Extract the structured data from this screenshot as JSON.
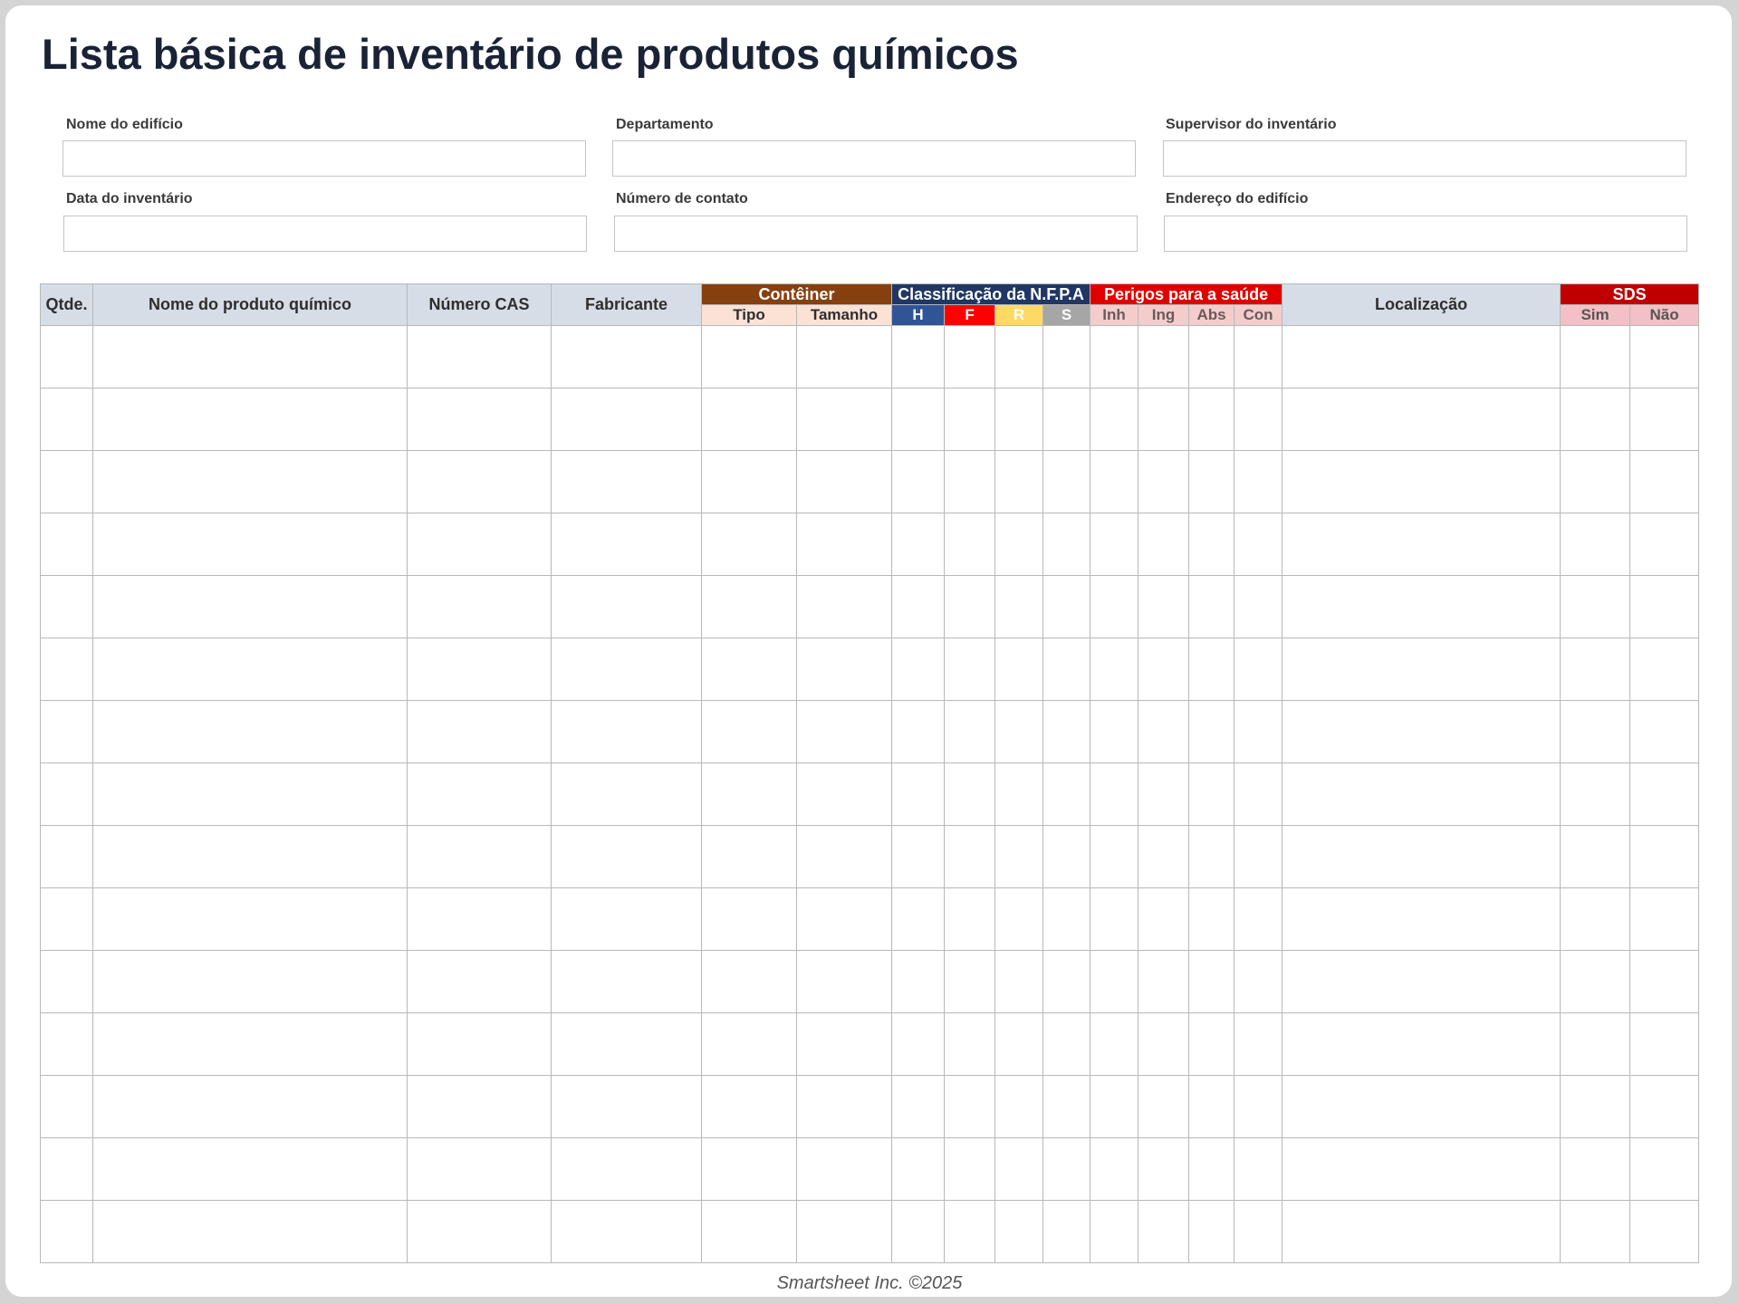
{
  "title": "Lista básica de inventário de produtos químicos",
  "fields": [
    {
      "label": "Nome do edifício",
      "value": ""
    },
    {
      "label": "Departamento",
      "value": ""
    },
    {
      "label": "Supervisor do inventário",
      "value": ""
    },
    {
      "label": "Data do inventário",
      "value": ""
    },
    {
      "label": "Número de contato",
      "value": ""
    },
    {
      "label": "Endereço do edifício",
      "value": ""
    }
  ],
  "table": {
    "headers": {
      "qty": "Qtde.",
      "chemical_name": "Nome do produto químico",
      "cas_number": "Número CAS",
      "manufacturer": "Fabricante",
      "location": "Localização"
    },
    "groups": {
      "container": {
        "label": "Contêiner",
        "sub": [
          "Tipo",
          "Tamanho"
        ]
      },
      "nfpa": {
        "label": "Classificação da N.F.P.A",
        "sub": [
          "H",
          "F",
          "R",
          "S"
        ]
      },
      "health": {
        "label": "Perigos para a saúde",
        "sub": [
          "Inh",
          "Ing",
          "Abs",
          "Con"
        ]
      },
      "sds": {
        "label": "SDS",
        "sub": [
          "Sim",
          "Não"
        ]
      }
    },
    "empty_rows": 15
  },
  "colors": {
    "container": "#86400f",
    "container_sub": "#fbe2d5",
    "nfpa": "#203764",
    "nfpa_h": "#2f5597",
    "nfpa_f": "#ff0000",
    "nfpa_r": "#ffd966",
    "nfpa_s": "#a6a6a6",
    "health": "#e00000",
    "health_sub": "#f4cccc",
    "sds": "#c00000",
    "sds_sub": "#f2c0c6",
    "header_bg": "#d6dde7"
  },
  "footer": "Smartsheet Inc. ©2025"
}
